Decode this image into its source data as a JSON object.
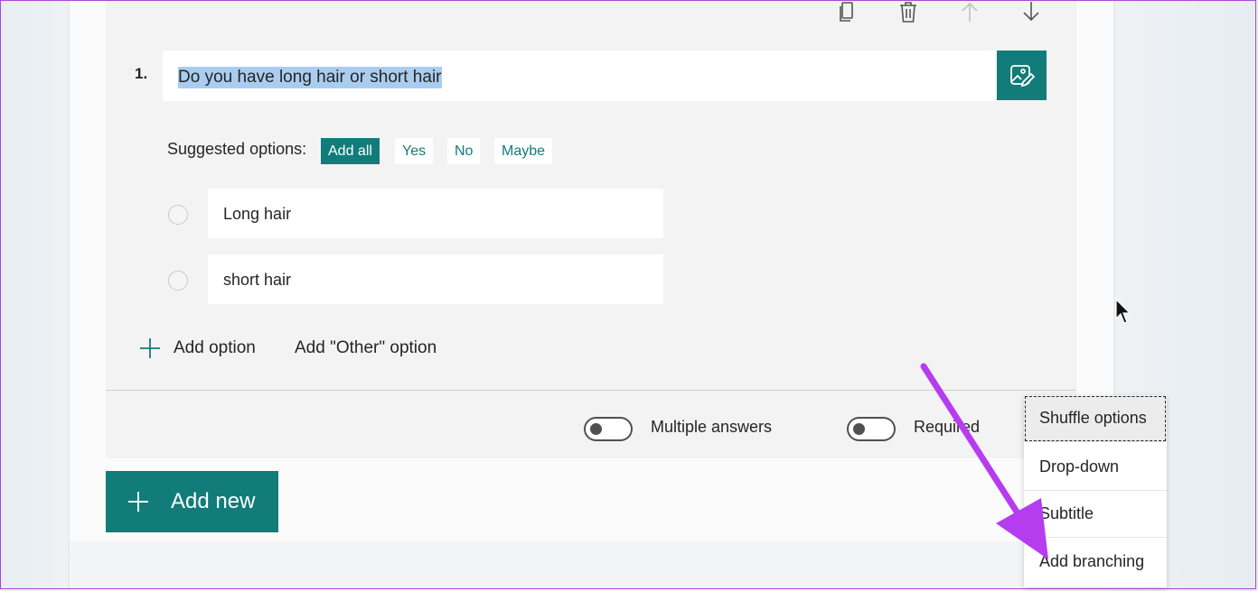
{
  "toolbar": {
    "copy_icon": "copy-icon",
    "delete_icon": "trash-icon",
    "move_up_icon": "arrow-up-icon",
    "move_down_icon": "arrow-down-icon"
  },
  "question": {
    "number": "1.",
    "title": "Do you have long hair or short hair"
  },
  "suggested": {
    "label": "Suggested options:",
    "add_all": "Add all",
    "options": [
      "Yes",
      "No",
      "Maybe"
    ]
  },
  "options": [
    "Long hair",
    "short hair"
  ],
  "actions": {
    "add_option": "Add option",
    "add_other": "Add \"Other\" option"
  },
  "toggles": {
    "multiple_answers": "Multiple answers",
    "required": "Required"
  },
  "add_new": "Add new",
  "menu": {
    "items": [
      "Shuffle options",
      "Drop-down",
      "Subtitle",
      "Add branching"
    ]
  },
  "colors": {
    "accent": "#117c7a",
    "selection": "#a9cdf0",
    "annotation_arrow": "#b63cf0"
  }
}
